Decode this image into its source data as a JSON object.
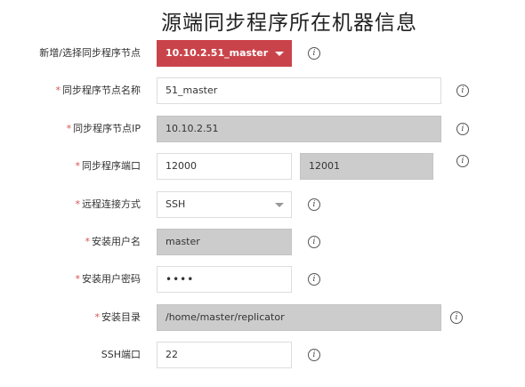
{
  "title": "源端同步程序所在机器信息",
  "fields": [
    {
      "label": "新增/选择同步程序节点",
      "required": false,
      "value": "10.10.2.51_master"
    },
    {
      "label": "同步程序节点名称",
      "required": true,
      "value": "51_master"
    },
    {
      "label": "同步程序节点IP",
      "required": true,
      "value": "10.10.2.51"
    },
    {
      "label": "同步程序端口",
      "required": true,
      "value": "12000",
      "value2": "12001"
    },
    {
      "label": "远程连接方式",
      "required": true,
      "value": "SSH"
    },
    {
      "label": "安装用户名",
      "required": true,
      "value": "master"
    },
    {
      "label": "安装用户密码",
      "required": true,
      "value": "••••"
    },
    {
      "label": "安装目录",
      "required": true,
      "value": "/home/master/replicator"
    },
    {
      "label": "SSH端口",
      "required": false,
      "value": "22"
    }
  ],
  "required_mark": "*",
  "info_glyph": "i",
  "colors": {
    "accent": "#c9444a",
    "required": "#d9534f",
    "disabled": "#cccccc"
  }
}
